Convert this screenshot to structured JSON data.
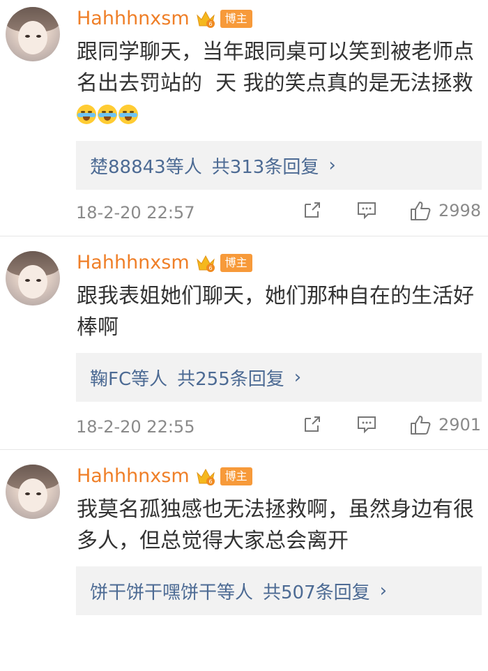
{
  "comments": [
    {
      "username": "Hahhhnxsm",
      "badge": "博主",
      "text": "跟同学聊天，当年跟同桌可以笑到被老师点名出去罚站的  天 我的笑点真的是无法拯救",
      "emoji_count": 3,
      "emoji_icon": "laughing-crying-emoji",
      "reply_users": "楚88843等人",
      "reply_count": "共313条回复",
      "time": "18-2-20 22:57",
      "likes": "2998"
    },
    {
      "username": "Hahhhnxsm",
      "badge": "博主",
      "text": "跟我表姐她们聊天，她们那种自在的生活好棒啊",
      "reply_users": "鞠FC等人",
      "reply_count": "共255条回复",
      "time": "18-2-20 22:55",
      "likes": "2901"
    },
    {
      "username": "Hahhhnxsm",
      "badge": "博主",
      "text": "我莫名孤独感也无法拯救啊，虽然身边有很多人，但总觉得大家总会离开",
      "reply_users": "饼干饼干嘿饼干等人",
      "reply_count": "共507条回复",
      "time": "",
      "likes": ""
    }
  ],
  "colors": {
    "username": "#ef7f28",
    "badge_bg": "#f79a3a",
    "reply_link": "#4d6b94",
    "meta_gray": "#8a8a8a"
  },
  "icons": [
    "share-icon",
    "comment-icon",
    "like-icon",
    "crown-icon",
    "chevron-right-icon"
  ]
}
